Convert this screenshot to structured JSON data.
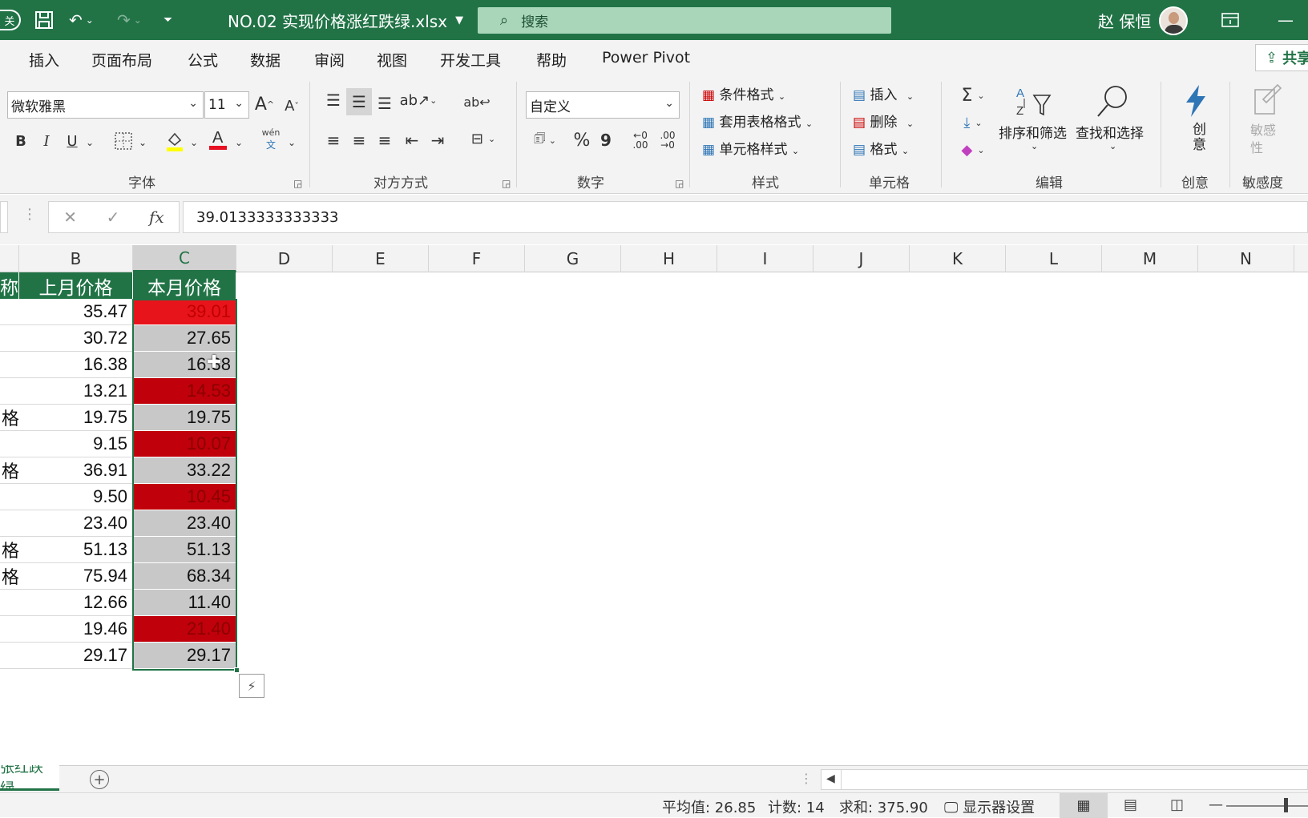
{
  "titlebar": {
    "filename": "NO.02 实现价格涨红跌绿.xlsx",
    "search_placeholder": "搜索",
    "user": "赵 保恒"
  },
  "ribbon_tabs": [
    "插入",
    "页面布局",
    "公式",
    "数据",
    "审阅",
    "视图",
    "开发工具",
    "帮助",
    "Power Pivot"
  ],
  "share_label": "共享",
  "font_group": {
    "label": "字体",
    "font_name": "微软雅黑",
    "font_size": "11",
    "grow": "A",
    "shrink": "A",
    "bold": "B",
    "italic": "I",
    "underline": "U",
    "phonetic": "wén"
  },
  "align_group": {
    "label": "对方方式"
  },
  "number_group": {
    "label": "数字",
    "format": "自定义",
    "percent": "%",
    "comma": "9",
    "inc_decimal": ".00",
    "dec_decimal": ".00"
  },
  "styles_group": {
    "label": "样式",
    "conditional": "条件格式",
    "table_format": "套用表格格式",
    "cell_style": "单元格样式"
  },
  "cells_group": {
    "label": "单元格",
    "insert": "插入",
    "delete": "删除",
    "format": "格式"
  },
  "editing_group": {
    "label": "编辑",
    "sort_filter": "排序和筛选",
    "find_select": "查找和选择"
  },
  "ideas_group": {
    "label": "创意",
    "button": "创意"
  },
  "sensitivity_group": {
    "label": "敏感度",
    "button": "敏感性"
  },
  "formula_bar": {
    "value": "39.0133333333333"
  },
  "columns": [
    "B",
    "C",
    "D",
    "E",
    "F",
    "G",
    "H",
    "I",
    "J",
    "K",
    "L",
    "M",
    "N"
  ],
  "table": {
    "headers": {
      "a_fragment": "称",
      "b": "上月价格",
      "c": "本月价格"
    },
    "rows": [
      {
        "a": "",
        "b": "35.47",
        "c": "39.01",
        "fill": "up"
      },
      {
        "a": "",
        "b": "30.72",
        "c": "27.65",
        "fill": "none"
      },
      {
        "a": "",
        "b": "16.38",
        "c": "16.38",
        "fill": "none"
      },
      {
        "a": "",
        "b": "13.21",
        "c": "14.53",
        "fill": "up-dark"
      },
      {
        "a": "格",
        "b": "19.75",
        "c": "19.75",
        "fill": "none"
      },
      {
        "a": "",
        "b": "9.15",
        "c": "10.07",
        "fill": "up-dark"
      },
      {
        "a": "格",
        "b": "36.91",
        "c": "33.22",
        "fill": "none"
      },
      {
        "a": "",
        "b": "9.50",
        "c": "10.45",
        "fill": "up-dark"
      },
      {
        "a": "",
        "b": "23.40",
        "c": "23.40",
        "fill": "none"
      },
      {
        "a": "格",
        "b": "51.13",
        "c": "51.13",
        "fill": "none"
      },
      {
        "a": "格",
        "b": "75.94",
        "c": "68.34",
        "fill": "none"
      },
      {
        "a": "",
        "b": "12.66",
        "c": "11.40",
        "fill": "none"
      },
      {
        "a": "",
        "b": "19.46",
        "c": "21.40",
        "fill": "up-dark"
      },
      {
        "a": "",
        "b": "29.17",
        "c": "29.17",
        "fill": "none"
      }
    ]
  },
  "colors": {
    "brand": "#217346",
    "up": "#e8141b",
    "up_dark": "#c0000b",
    "neutral": "#c8c8c8"
  },
  "sheet_tab": "张红跌绿",
  "status": {
    "average": "平均值: 26.85",
    "count": "计数: 14",
    "sum": "求和: 375.90",
    "display_settings": "显示器设置"
  }
}
